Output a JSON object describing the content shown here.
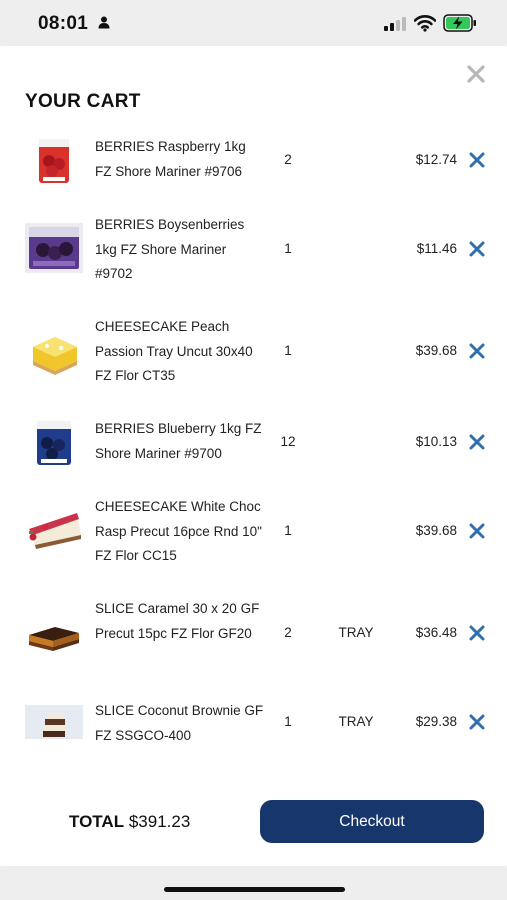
{
  "status_bar": {
    "time": "08:01",
    "icons": [
      "person-icon",
      "signal-icon",
      "wifi-icon",
      "battery-charging-icon"
    ]
  },
  "cart": {
    "title": "YOUR CART",
    "items": [
      {
        "name": "BERRIES Raspberry 1kg FZ Shore Mariner #9706",
        "qty": "2",
        "unit": "",
        "price": "$12.74"
      },
      {
        "name": "BERRIES Boysenberries 1kg FZ Shore Mariner #9702",
        "qty": "1",
        "unit": "",
        "price": "$11.46"
      },
      {
        "name": "CHEESECAKE Peach Passion Tray Uncut 30x40 FZ Flor CT35",
        "qty": "1",
        "unit": "",
        "price": "$39.68"
      },
      {
        "name": "BERRIES Blueberry 1kg FZ Shore Mariner #9700",
        "qty": "12",
        "unit": "",
        "price": "$10.13"
      },
      {
        "name": "CHEESECAKE White Choc Rasp Precut 16pce Rnd 10\" FZ Flor CC15",
        "qty": "1",
        "unit": "",
        "price": "$39.68"
      },
      {
        "name": "SLICE Caramel 30 x 20 GF Precut 15pc FZ Flor GF20",
        "qty": "2",
        "unit": "TRAY",
        "price": "$36.48"
      },
      {
        "name": "SLICE Coconut Brownie GF FZ SSGCO-400",
        "qty": "1",
        "unit": "TRAY",
        "price": "$29.38"
      }
    ],
    "total_label": "TOTAL",
    "total_value": "$391.23",
    "checkout_label": "Checkout"
  },
  "colors": {
    "accent": "#17366b",
    "remove_icon": "#2f6fb0",
    "close_icon": "#b8b8b8"
  }
}
